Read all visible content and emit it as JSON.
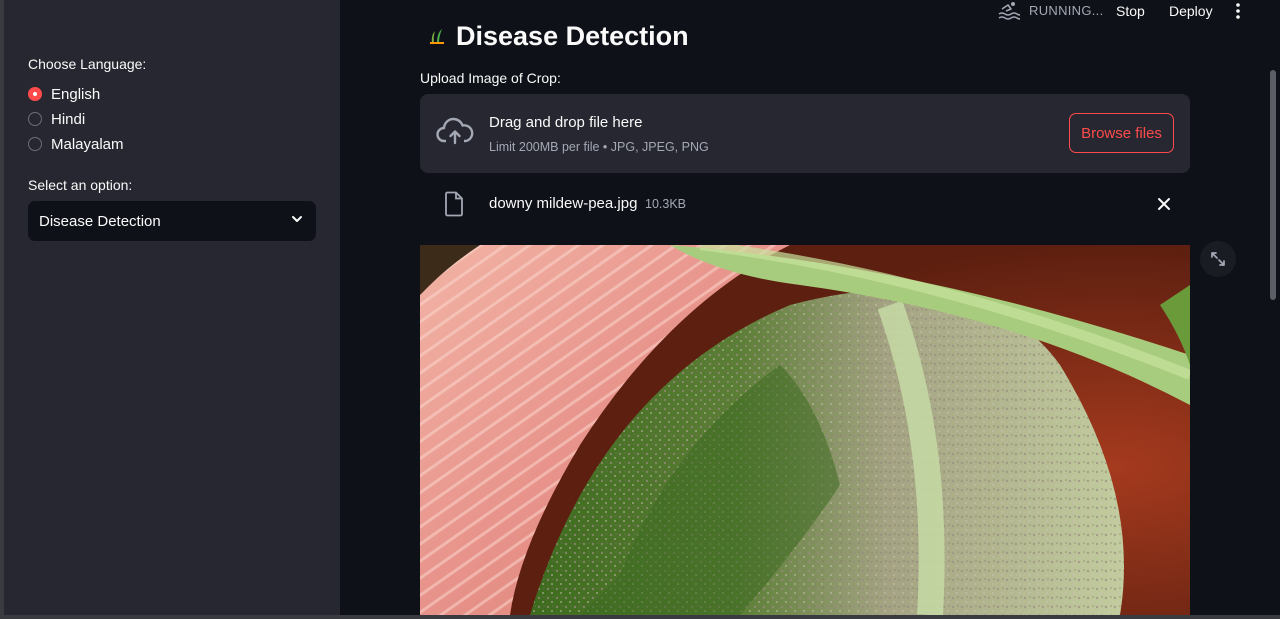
{
  "sidebar": {
    "language_label": "Choose Language:",
    "languages": [
      "English",
      "Hindi",
      "Malayalam"
    ],
    "selected_language": "English",
    "option_label": "Select an option:",
    "selected_option": "Disease Detection"
  },
  "header": {
    "status": "RUNNING...",
    "stop_label": "Stop",
    "deploy_label": "Deploy"
  },
  "main": {
    "title": "Disease Detection",
    "upload_label": "Upload Image of Crop:",
    "dropzone": {
      "main_text": "Drag and drop file here",
      "limit_text": "Limit 200MB per file • JPG, JPEG, PNG",
      "browse_label": "Browse files"
    },
    "uploaded_file": {
      "name": "downy mildew-pea.jpg",
      "size": "10.3KB"
    }
  },
  "colors": {
    "accent": "#ff4b4b",
    "sidebar_bg": "#262730",
    "main_bg": "#0e1117"
  }
}
